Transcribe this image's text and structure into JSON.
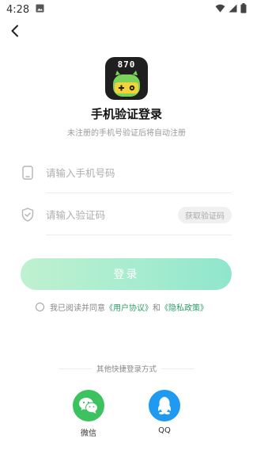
{
  "status_bar": {
    "time": "4:28"
  },
  "header": {
    "back_icon": "chevron-left-icon"
  },
  "logo": {
    "number": "870"
  },
  "title": "手机验证登录",
  "subtitle": "未注册的手机号验证后将自动注册",
  "phone": {
    "placeholder": "请输入手机号码",
    "icon": "phone-icon"
  },
  "code": {
    "placeholder": "请输入验证码",
    "icon": "shield-icon",
    "get_code_label": "获取验证码"
  },
  "login_label": "登录",
  "agreement": {
    "prefix": "我已阅读并同意",
    "user_agreement": "《用户协议》",
    "and": "和",
    "privacy_policy": "《隐私政策》"
  },
  "other_login": {
    "label": "其他快捷登录方式",
    "wechat": "微信",
    "qq": "QQ"
  },
  "colors": {
    "accent": "#2f9e67",
    "login_gradient_start": "#bff1cf",
    "login_gradient_end": "#8fe6cc",
    "wechat": "#3cc25f",
    "qq": "#1e9bf0"
  }
}
